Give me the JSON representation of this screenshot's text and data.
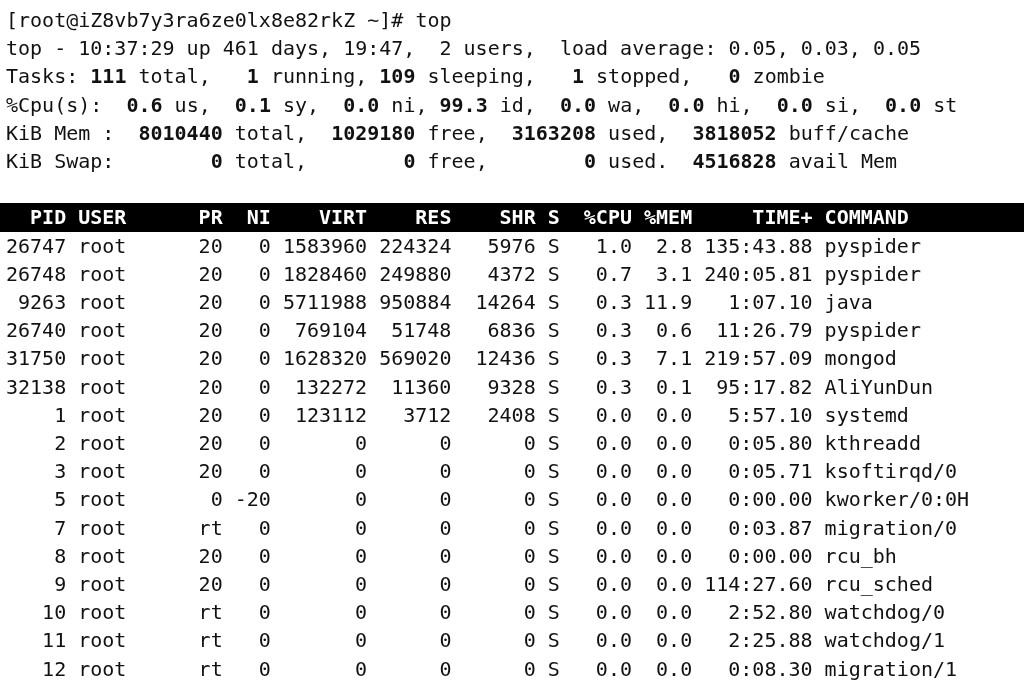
{
  "prompt": {
    "text": "[root@iZ8vb7y3ra6ze0lx8e82rkZ ~]# top"
  },
  "summary_lines": [
    "top - 10:37:29 up 461 days, 19:47,  2 users,  load average: 0.05, 0.03, 0.05",
    "Tasks: **111** total,   **1** running, **109** sleeping,   **1** stopped,   **0** zombie",
    "%Cpu(s):  **0.6** us,  **0.1** sy,  **0.0** ni, **99.3** id,  **0.0** wa,  **0.0** hi,  **0.0** si,  **0.0** st",
    "KiB Mem :  **8010440** total,  **1029180** free,  **3163208** used,  **3818052** buff/cache",
    "KiB Swap:        **0** total,        **0** free,        **0** used.  **4516828** avail Mem"
  ],
  "process_table": {
    "columns": [
      "PID",
      "USER",
      "PR",
      "NI",
      "VIRT",
      "RES",
      "SHR",
      "S",
      "%CPU",
      "%MEM",
      "TIME+",
      "COMMAND"
    ],
    "rows": [
      [
        "26747",
        "root",
        "20",
        "0",
        "1583960",
        "224324",
        "5976",
        "S",
        "1.0",
        "2.8",
        "135:43.88",
        "pyspider"
      ],
      [
        "26748",
        "root",
        "20",
        "0",
        "1828460",
        "249880",
        "4372",
        "S",
        "0.7",
        "3.1",
        "240:05.81",
        "pyspider"
      ],
      [
        "9263",
        "root",
        "20",
        "0",
        "5711988",
        "950884",
        "14264",
        "S",
        "0.3",
        "11.9",
        "1:07.10",
        "java"
      ],
      [
        "26740",
        "root",
        "20",
        "0",
        "769104",
        "51748",
        "6836",
        "S",
        "0.3",
        "0.6",
        "11:26.79",
        "pyspider"
      ],
      [
        "31750",
        "root",
        "20",
        "0",
        "1628320",
        "569020",
        "12436",
        "S",
        "0.3",
        "7.1",
        "219:57.09",
        "mongod"
      ],
      [
        "32138",
        "root",
        "20",
        "0",
        "132272",
        "11360",
        "9328",
        "S",
        "0.3",
        "0.1",
        "95:17.82",
        "AliYunDun"
      ],
      [
        "1",
        "root",
        "20",
        "0",
        "123112",
        "3712",
        "2408",
        "S",
        "0.0",
        "0.0",
        "5:57.10",
        "systemd"
      ],
      [
        "2",
        "root",
        "20",
        "0",
        "0",
        "0",
        "0",
        "S",
        "0.0",
        "0.0",
        "0:05.80",
        "kthreadd"
      ],
      [
        "3",
        "root",
        "20",
        "0",
        "0",
        "0",
        "0",
        "S",
        "0.0",
        "0.0",
        "0:05.71",
        "ksoftirqd/0"
      ],
      [
        "5",
        "root",
        "0",
        "-20",
        "0",
        "0",
        "0",
        "S",
        "0.0",
        "0.0",
        "0:00.00",
        "kworker/0:0H"
      ],
      [
        "7",
        "root",
        "rt",
        "0",
        "0",
        "0",
        "0",
        "S",
        "0.0",
        "0.0",
        "0:03.87",
        "migration/0"
      ],
      [
        "8",
        "root",
        "20",
        "0",
        "0",
        "0",
        "0",
        "S",
        "0.0",
        "0.0",
        "0:00.00",
        "rcu_bh"
      ],
      [
        "9",
        "root",
        "20",
        "0",
        "0",
        "0",
        "0",
        "S",
        "0.0",
        "0.0",
        "114:27.60",
        "rcu_sched"
      ],
      [
        "10",
        "root",
        "rt",
        "0",
        "0",
        "0",
        "0",
        "S",
        "0.0",
        "0.0",
        "2:52.80",
        "watchdog/0"
      ],
      [
        "11",
        "root",
        "rt",
        "0",
        "0",
        "0",
        "0",
        "S",
        "0.0",
        "0.0",
        "2:25.88",
        "watchdog/1"
      ],
      [
        "12",
        "root",
        "rt",
        "0",
        "0",
        "0",
        "0",
        "S",
        "0.0",
        "0.0",
        "0:08.30",
        "migration/1"
      ]
    ]
  }
}
